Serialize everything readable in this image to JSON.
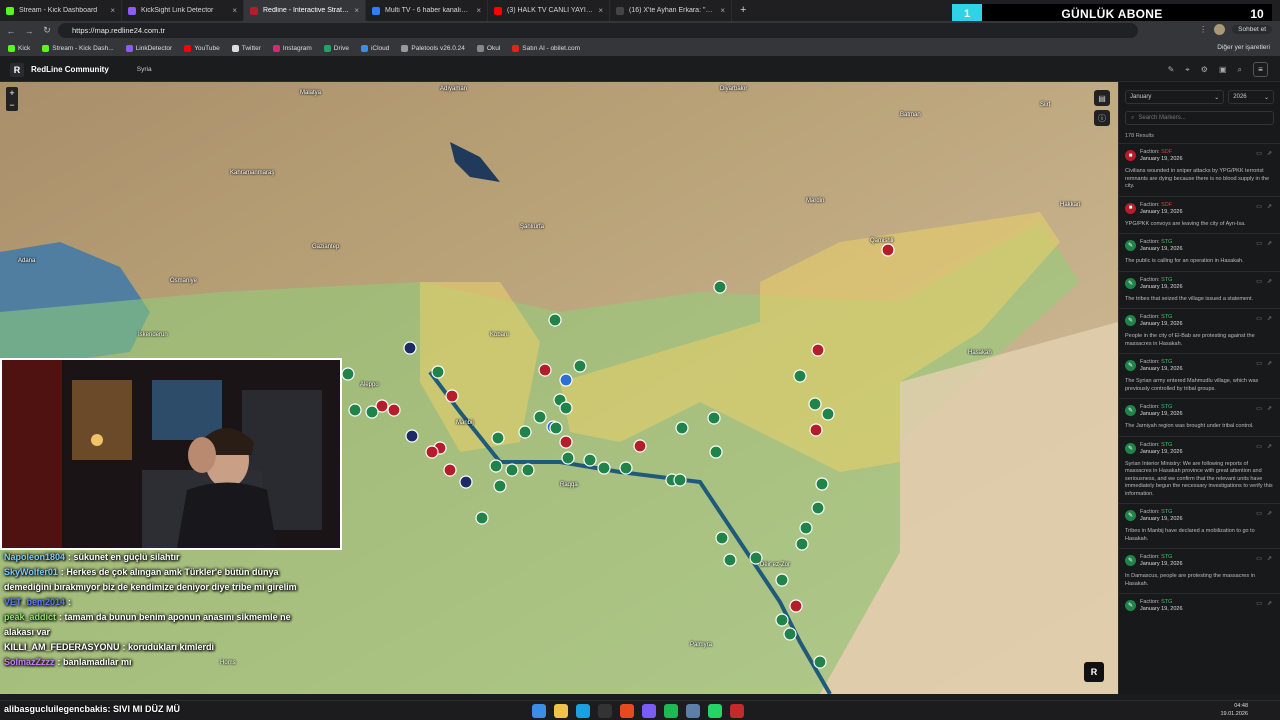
{
  "browser": {
    "tabs": [
      {
        "title": "Stream - Kick Dashboard",
        "color": "#53fc18",
        "active": false
      },
      {
        "title": "KickSight Link Detector",
        "color": "#8d5cf6",
        "active": false
      },
      {
        "title": "Redline - Interactive Strategic Map",
        "color": "#b51d2a",
        "active": true
      },
      {
        "title": "Multi TV - 6 haber kanalını aynı an",
        "color": "#2d7ff9",
        "active": false
      },
      {
        "title": "(3) HALK TV CANLI YAYINI | FULL H",
        "color": "#ff0000",
        "active": false
      },
      {
        "title": "(16) X'te Ayhan Erkara: \"Haseke'd",
        "color": "#444444",
        "active": false
      }
    ],
    "new_tab": "+",
    "url": "https://map.redline24.com.tr",
    "chat_button": "Sohbet et",
    "banner": {
      "label": "GÜNLÜK ABONE",
      "count": "10",
      "accent": "1"
    },
    "bookmarks": [
      {
        "label": "Kick",
        "color": "#53fc18"
      },
      {
        "label": "Stream - Kick Dash...",
        "color": "#53fc18"
      },
      {
        "label": "LinkDetector",
        "color": "#8d5cf6"
      },
      {
        "label": "YouTube",
        "color": "#ff0000"
      },
      {
        "label": "Twitter",
        "color": "#dddddd"
      },
      {
        "label": "Instagram",
        "color": "#d62976"
      },
      {
        "label": "Drive",
        "color": "#1fa463"
      },
      {
        "label": "iCloud",
        "color": "#3a8ee6"
      },
      {
        "label": "Paletools v26.0.24",
        "color": "#999999"
      },
      {
        "label": "Okul",
        "color": "#888888"
      },
      {
        "label": "Satın Al - obilet.com",
        "color": "#e2231a"
      }
    ],
    "bookmarks_other": "Diğer yer işaretleri"
  },
  "app": {
    "logo": "R",
    "name": "RedLine Community",
    "region": "Syria"
  },
  "map": {
    "cities": [
      "Adıyaman",
      "Malatya",
      "Diyarbakır",
      "Batman",
      "Siirt",
      "Kahramanmaraş",
      "Gaziantep",
      "Şanlıurfa",
      "Mardin",
      "Adana",
      "Osmaniye",
      "İskenderun",
      "Hakkari",
      "Qamishli",
      "Raqqa",
      "Deir ez-Zor",
      "Homs",
      "Palmyra",
      "Hasakah",
      "Kobani",
      "Manbij",
      "Aleppo"
    ],
    "logo": "R"
  },
  "sidebar": {
    "month": "January",
    "year": "2026",
    "search_placeholder": "Search Markers...",
    "results": "178 Results",
    "faction_label": "Faction:",
    "events": [
      {
        "faction": "SDF",
        "date": "January 19, 2026",
        "text": "Civilians wounded in sniper attacks by YPG/PKK terrorist remnants are dying because there is no blood supply in the city."
      },
      {
        "faction": "SDF",
        "date": "January 19, 2026",
        "text": "YPG/PKK convoys are leaving the city of Ayn-Isa."
      },
      {
        "faction": "STG",
        "date": "January 19, 2026",
        "text": "The public is calling for an operation in Hasakah."
      },
      {
        "faction": "STG",
        "date": "January 19, 2026",
        "text": "The tribes that seized the village issued a statement."
      },
      {
        "faction": "STG",
        "date": "January 19, 2026",
        "text": "People in the city of El-Bab are protesting against the massacres in Hasakah."
      },
      {
        "faction": "STG",
        "date": "January 19, 2026",
        "text": "The Syrian army entered Mahmudlu village, which was previously controlled by tribal groups."
      },
      {
        "faction": "STG",
        "date": "January 19, 2026",
        "text": "The Jarniyah region was brought under tribal control."
      },
      {
        "faction": "STG",
        "date": "January 19, 2026",
        "text": "Syrian Interior Ministry: We are following reports of massacres in Hasakah province with great attention and seriousness, and we confirm that the relevant units have immediately begun the necessary investigations to verify this information."
      },
      {
        "faction": "STG",
        "date": "January 19, 2026",
        "text": "Tribes in Manbij have declared a mobilization to go to Hasakah."
      },
      {
        "faction": "STG",
        "date": "January 19, 2026",
        "text": "In Damascus, people are protesting the massacres in Hasakah."
      },
      {
        "faction": "STG",
        "date": "January 19, 2026",
        "text": ""
      }
    ]
  },
  "chat": [
    {
      "user": "Napoleon1804",
      "color": "#7ec8ff",
      "text": ": sükunet en güçlü silahtır"
    },
    {
      "user": "SkyWolfer01",
      "color": "#7ec8ff",
      "text": ": Herkes de çok alıngan amk Türkler'e bütün dünya demediğini bırakmıyor biz de kendimize deniyor diye tribe mi girelim"
    },
    {
      "user": "VET_bem2014",
      "color": "#5a7bff",
      "text": ":"
    },
    {
      "user": "peak_addict",
      "color": "#8fe36b",
      "text": ": tamam da bunun benim aponun anasını sikmemle ne alakası var"
    },
    {
      "user": "KILLI_AM_FEDERASYONU",
      "color": "#ffffff",
      "text": ": korudukları kimlerdi"
    },
    {
      "user": "SolmazZzzz",
      "color": "#c77dff",
      "text": ": banlamadılar mı"
    }
  ],
  "taskbar": {
    "marquee_user": "alibasgucluilegencbakis",
    "marquee_text": ": SIVI MI DÜZ MÜ",
    "time": "04:48",
    "date": "19.01.2026"
  },
  "colors": {
    "sdf": "#b51d2a",
    "stg": "#20844a",
    "zone_yellow": "#e6cf6a",
    "zone_green": "#8fcf7a"
  }
}
